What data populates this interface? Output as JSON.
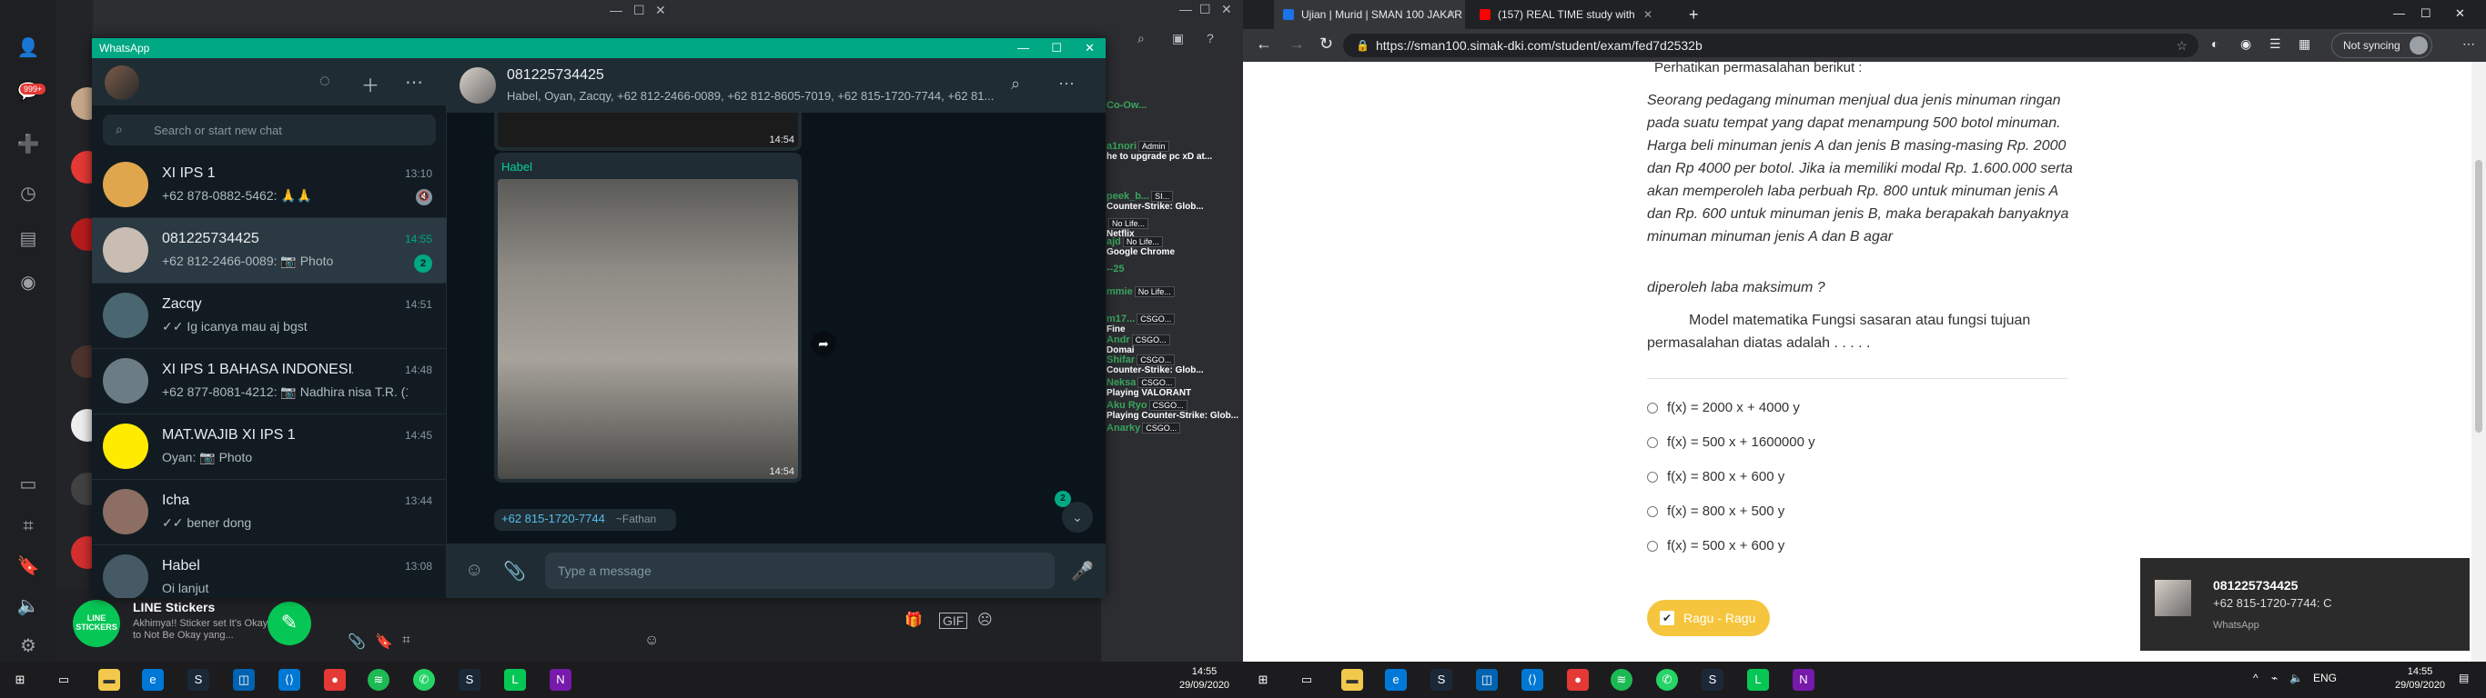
{
  "colors": {
    "whatsapp_green": "#00a884",
    "line_green": "#06c755",
    "ragu": "#f5c53d"
  },
  "line_app": {
    "badge": "999+",
    "sticker_title": "LINE Stickers",
    "sticker_sub": "Akhimya!! Sticker set It's Okay to Not Be Okay yang...",
    "sticker_icon_text": "LINE STICKERS"
  },
  "discord": {
    "items": [
      {
        "name": "Co-Ow...",
        "tag": "",
        "sub": ""
      },
      {
        "name": "a1nori",
        "tag": "Admin",
        "sub": "he to upgrade pc xD at..."
      },
      {
        "name": "peek_b...",
        "tag": "SI...",
        "sub": "Counter-Strike: Glob..."
      },
      {
        "name": "",
        "tag": "No Life...",
        "sub": "Netflix"
      },
      {
        "name": "ajd",
        "tag": "No Life...",
        "sub": "Google Chrome"
      },
      {
        "name": "--25",
        "tag": "",
        "sub": ""
      },
      {
        "name": "mmie",
        "tag": "No Life...",
        "sub": ""
      },
      {
        "name": "m17...",
        "tag": "CSGO...",
        "sub": "Fine"
      },
      {
        "name": "Andr",
        "tag": "CSGO...",
        "sub": "Domai"
      },
      {
        "name": "Shifar",
        "tag": "CSGO...",
        "sub": "Counter-Strike: Glob..."
      },
      {
        "name": "Neksa",
        "tag": "CSGO...",
        "sub": "Playing VALORANT"
      },
      {
        "name": "Aku Ryo",
        "tag": "CSGO...",
        "sub": "Playing Counter-Strike: Glob..."
      },
      {
        "name": "Anarky",
        "tag": "CSGO...",
        "sub": ""
      }
    ]
  },
  "whatsapp": {
    "window_title": "WhatsApp",
    "search_placeholder": "Search or start new chat",
    "chats": [
      {
        "name": "XI IPS 1",
        "last": "+62 878-0882-5462: 🙏🙏",
        "time": "13:10",
        "muted": true
      },
      {
        "name": "081225734425",
        "last": "+62 812-2466-0089: 📷 Photo",
        "time": "14:55",
        "unread": "2"
      },
      {
        "name": "Zacqy",
        "last": "✓✓ Ig icanya mau aj bgst",
        "time": "14:51"
      },
      {
        "name": "XI IPS 1 BAHASA INDONESIA",
        "last": "+62 877-8081-4212: 📷 Nadhira nisa T.R. (1...",
        "time": "14:48"
      },
      {
        "name": "MAT.WAJIB XI IPS 1",
        "last": "Oyan: 📷 Photo",
        "time": "14:45"
      },
      {
        "name": "Icha",
        "last": "✓✓ bener dong",
        "time": "13:44"
      },
      {
        "name": "Habel",
        "last": "Oi lanjut",
        "time": "13:08"
      }
    ],
    "conversation": {
      "title": "081225734425",
      "subtitle": "Habel, Oyan, Zacqy, +62 812-2466-0089, +62 812-8605-7019, +62 815-1720-7744, +62 81...",
      "msg1_time": "14:54",
      "msg2_sender": "Habel",
      "msg2_time": "14:54",
      "msg3_sender": "+62 815-1720-7744",
      "msg3_sender_sub": "~Fathan",
      "scroll_badge": "2",
      "composer_placeholder": "Type a message"
    }
  },
  "browser": {
    "tabs": [
      {
        "title": "Ujian | Murid | SMAN 100 JAKAR",
        "active": true
      },
      {
        "title": "(157) REAL TIME study with",
        "active": false
      }
    ],
    "url": "https://sman100.simak-dki.com/student/exam/fed7d2532b",
    "sync_label": "Not syncing",
    "question": {
      "heading": "Perhatikan permasalahan berikut :",
      "body": "Seorang pedagang minuman menjual dua jenis minuman ringan pada suatu tempat yang dapat menampung 500 botol minuman. Harga beli minuman jenis A dan jenis B masing-masing Rp. 2000 dan Rp 4000 per botol.  Jika ia memiliki modal Rp. 1.600.000 serta akan memperoleh laba perbuah Rp. 800 untuk minuman jenis A dan Rp. 600 untuk minuman jenis B, maka berapakah banyaknya minuman minuman jenis A dan B agar",
      "body2": "diperoleh laba maksimum ?",
      "model": "Model matematika Fungsi sasaran atau fungsi tujuan permasalahan diatas adalah . . . . .",
      "options": [
        "f(x) = 2000 x + 4000 y",
        "f(x) = 500 x + 1600000 y",
        "f(x) = 800 x + 600 y",
        "f(x) = 800 x + 500 y",
        "f(x) = 500 x + 600 y"
      ],
      "ragu_label": "Ragu - Ragu"
    }
  },
  "notification": {
    "title": "081225734425",
    "message": "+62 815-1720-7744: C",
    "app": "WhatsApp"
  },
  "taskbar": {
    "time": "14:55",
    "date": "29/09/2020",
    "lang": "ENG"
  }
}
